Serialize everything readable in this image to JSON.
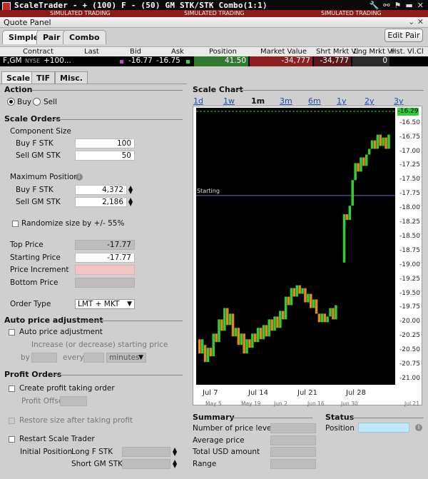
{
  "window": {
    "title": "ScaleTrader - + (100) F - (50) GM STK/STK Combo(1:1)",
    "simulated_labels": [
      "SIMULATED TRADING",
      "SIMULATED TRADING",
      "SIMULATED TRADING"
    ]
  },
  "quote_panel": {
    "title": "Quote Panel",
    "tabs": [
      "Simple",
      "Pair",
      "Combo"
    ],
    "edit_pair": "Edit Pair",
    "columns": [
      "Contract",
      "Last",
      "Bid",
      "Ask",
      "Position",
      "Market Value",
      "Shrt Mrkt Vl",
      "Lng Mrkt Vl",
      "Hst. Vl.",
      "Cl"
    ],
    "row": {
      "contract": "F,GM",
      "exchange": "NYSE",
      "contract_suffix": "+100...",
      "bid": "-16.77",
      "ask": "-16.75",
      "position": "41.50",
      "market_value": "-34,777",
      "short_market_value": "-34,777",
      "long_market_value": "0"
    }
  },
  "sub_tabs": [
    "Scale",
    "TIF",
    "Misc."
  ],
  "action": {
    "heading": "Action",
    "buy": "Buy",
    "sell": "Sell",
    "selected": "Buy"
  },
  "scale_orders": {
    "heading": "Scale Orders",
    "component_size": "Component Size",
    "buy_f": "Buy F STK",
    "buy_f_value": "100",
    "sell_gm": "Sell GM STK",
    "sell_gm_value": "50",
    "max_position": "Maximum Position",
    "max_buy_f": "Buy F STK",
    "max_buy_f_value": "4,372",
    "max_sell_gm": "Sell GM STK",
    "max_sell_gm_value": "2,186",
    "randomize": "Randomize size by +/- 55%",
    "top_price": "Top Price",
    "top_price_value": "-17.77",
    "starting_price": "Starting Price",
    "starting_price_value": "-17.77",
    "price_increment": "Price Increment",
    "bottom_price": "Bottom Price",
    "order_type": "Order Type",
    "order_type_value": "LMT + MKT"
  },
  "auto_price": {
    "heading": "Auto price adjustment",
    "checkbox": "Auto price adjustment",
    "desc": "Increase (or decrease) starting price",
    "by": "by",
    "every": "every",
    "unit": "minutes"
  },
  "profit_orders": {
    "heading": "Profit Orders",
    "create": "Create profit taking order",
    "offset": "Profit Offset",
    "restore": "Restore size after taking profit",
    "restart": "Restart Scale Trader",
    "initial_position": "Initial Position",
    "long_f": "Long F STK",
    "short_gm": "Short GM STK"
  },
  "scale_chart": {
    "heading": "Scale Chart",
    "ranges": [
      "1d",
      "1w",
      "1m",
      "3m",
      "6m",
      "1y",
      "2y",
      "3y"
    ],
    "active_range": "1m",
    "starting_label": "Starting",
    "last_price_tag": "-16.29"
  },
  "chart_data": {
    "type": "bar",
    "title": "",
    "y_ticks": [
      "-16.29",
      "-16.50",
      "-16.75",
      "-17.00",
      "-17.25",
      "-17.50",
      "-17.75",
      "-18.00",
      "-18.25",
      "-18.50",
      "-18.75",
      "-19.00",
      "-19.25",
      "-19.50",
      "-19.75",
      "-20.00",
      "-20.25",
      "-20.50",
      "-20.75",
      "-21.00"
    ],
    "ylim": [
      -21.25,
      -16.2
    ],
    "x_labels": [
      "Jul 7",
      "Jul 14",
      "Jul 21",
      "Jul 28"
    ],
    "x_sublabels": [
      "May 5",
      "May 19",
      "Jun 2",
      "Jun 16",
      "Jun 30",
      "Jul 21"
    ],
    "starting_price": -17.77,
    "top_price": -16.29,
    "bars": [
      {
        "x": 0,
        "open": -20.3,
        "close": -20.55
      },
      {
        "x": 1,
        "open": -20.55,
        "close": -20.3
      },
      {
        "x": 2,
        "open": -20.4,
        "close": -20.7
      },
      {
        "x": 3,
        "open": -20.7,
        "close": -20.45
      },
      {
        "x": 4,
        "open": -20.45,
        "close": -20.6
      },
      {
        "x": 5,
        "open": -20.6,
        "close": -20.2
      },
      {
        "x": 6,
        "open": -20.2,
        "close": -20.35
      },
      {
        "x": 7,
        "open": -20.35,
        "close": -19.95
      },
      {
        "x": 8,
        "open": -19.95,
        "close": -20.15
      },
      {
        "x": 9,
        "open": -20.15,
        "close": -19.75
      },
      {
        "x": 10,
        "open": -19.75,
        "close": -20.05
      },
      {
        "x": 11,
        "open": -20.05,
        "close": -19.85
      },
      {
        "x": 12,
        "open": -19.85,
        "close": -20.25
      },
      {
        "x": 13,
        "open": -20.25,
        "close": -20.1
      },
      {
        "x": 14,
        "open": -20.1,
        "close": -20.4
      },
      {
        "x": 15,
        "open": -20.4,
        "close": -20.2
      },
      {
        "x": 16,
        "open": -20.2,
        "close": -20.55
      },
      {
        "x": 17,
        "open": -20.55,
        "close": -20.3
      },
      {
        "x": 18,
        "open": -20.3,
        "close": -20.45
      },
      {
        "x": 19,
        "open": -20.45,
        "close": -20.2
      },
      {
        "x": 20,
        "open": -20.2,
        "close": -20.35
      },
      {
        "x": 21,
        "open": -20.35,
        "close": -20.1
      },
      {
        "x": 22,
        "open": -20.1,
        "close": -20.3
      },
      {
        "x": 23,
        "open": -20.3,
        "close": -20.05
      },
      {
        "x": 24,
        "open": -20.05,
        "close": -20.25
      },
      {
        "x": 25,
        "open": -20.25,
        "close": -19.95
      },
      {
        "x": 26,
        "open": -19.95,
        "close": -20.15
      },
      {
        "x": 27,
        "open": -20.15,
        "close": -19.9
      },
      {
        "x": 28,
        "open": -19.9,
        "close": -20.1
      },
      {
        "x": 29,
        "open": -20.1,
        "close": -19.8
      },
      {
        "x": 30,
        "open": -19.8,
        "close": -19.95
      },
      {
        "x": 31,
        "open": -19.95,
        "close": -19.55
      },
      {
        "x": 32,
        "open": -19.55,
        "close": -19.7
      },
      {
        "x": 33,
        "open": -19.7,
        "close": -19.4
      },
      {
        "x": 34,
        "open": -19.4,
        "close": -19.55
      },
      {
        "x": 35,
        "open": -19.55,
        "close": -19.35
      },
      {
        "x": 36,
        "open": -19.35,
        "close": -19.5
      },
      {
        "x": 37,
        "open": -19.5,
        "close": -19.4
      },
      {
        "x": 38,
        "open": -19.4,
        "close": -19.65
      },
      {
        "x": 39,
        "open": -19.65,
        "close": -19.5
      },
      {
        "x": 40,
        "open": -19.5,
        "close": -19.75
      },
      {
        "x": 41,
        "open": -19.75,
        "close": -19.6
      },
      {
        "x": 42,
        "open": -19.6,
        "close": -19.85
      },
      {
        "x": 43,
        "open": -19.85,
        "close": -20.0
      },
      {
        "x": 44,
        "open": -20.0,
        "close": -19.85
      },
      {
        "x": 45,
        "open": -19.85,
        "close": -20.0
      },
      {
        "x": 46,
        "open": -20.0,
        "close": -19.9
      },
      {
        "x": 47,
        "open": -19.9,
        "close": -19.75
      },
      {
        "x": 48,
        "open": -19.75,
        "close": -19.95
      },
      {
        "x": 49,
        "open": -19.95,
        "close": -19.7
      },
      {
        "x": 52,
        "open": -18.95,
        "close": -18.1
      },
      {
        "x": 53,
        "open": -18.1,
        "close": -18.2
      },
      {
        "x": 54,
        "open": -18.2,
        "close": -17.95
      },
      {
        "x": 55,
        "open": -17.95,
        "close": -17.5
      },
      {
        "x": 56,
        "open": -17.5,
        "close": -17.2
      },
      {
        "x": 57,
        "open": -17.2,
        "close": -17.35
      },
      {
        "x": 58,
        "open": -17.35,
        "close": -17.1
      },
      {
        "x": 59,
        "open": -17.1,
        "close": -17.25
      },
      {
        "x": 60,
        "open": -17.25,
        "close": -17.05
      },
      {
        "x": 61,
        "open": -17.05,
        "close": -16.95
      },
      {
        "x": 62,
        "open": -16.95,
        "close": -16.8
      },
      {
        "x": 63,
        "open": -16.8,
        "close": -16.95
      },
      {
        "x": 64,
        "open": -16.95,
        "close": -16.7
      },
      {
        "x": 65,
        "open": -16.7,
        "close": -16.9
      },
      {
        "x": 66,
        "open": -16.9,
        "close": -16.75
      },
      {
        "x": 67,
        "open": -16.75,
        "close": -16.95
      },
      {
        "x": 68,
        "open": -16.95,
        "close": -16.7
      }
    ],
    "up_color": "#33cc33",
    "down_color": "#e08a1e"
  },
  "summary": {
    "heading": "Summary",
    "rows": [
      "Number of price levels",
      "Average price",
      "Total USD amount",
      "Range"
    ]
  },
  "status": {
    "heading": "Status",
    "position": "Position"
  },
  "colors": {
    "title_bg": "#0a0a0a",
    "sim_bar": "#8c1b1b",
    "chart_bg": "#000000",
    "start_line": "#6a6ad8",
    "top_line": "#33cc33"
  }
}
